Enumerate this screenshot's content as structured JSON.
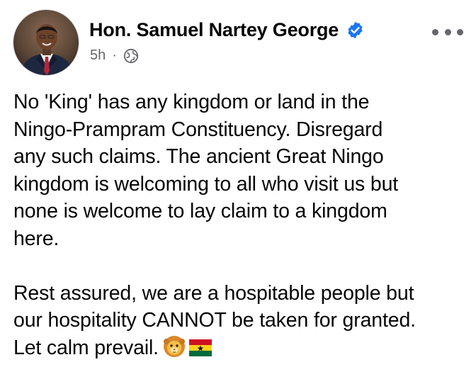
{
  "post": {
    "author": {
      "name": "Hon. Samuel Nartey George",
      "avatar_icon": "profile-photo",
      "verified": true,
      "verified_badge_icon": "verified-badge-icon"
    },
    "time": "5h",
    "separator": "·",
    "audience_icon": "globe-icon",
    "menu_icon": "more-options-icon",
    "paragraphs": [
      "No 'King' has any kingdom or land in the\nNingo-Prampram Constituency. Disregard\nany such claims. The ancient Great Ningo\nkingdom is welcoming to all who visit us but\nnone is welcome to lay claim to a kingdom\nhere.",
      "Rest assured, we are a hospitable people but\nour hospitality CANNOT be taken for granted.\nLet calm prevail."
    ],
    "emojis": [
      "lion-face-emoji",
      "ghana-flag-emoji"
    ]
  },
  "colors": {
    "text_primary": "#050505",
    "text_secondary": "#65676b",
    "verified_blue": "#1877f2"
  }
}
